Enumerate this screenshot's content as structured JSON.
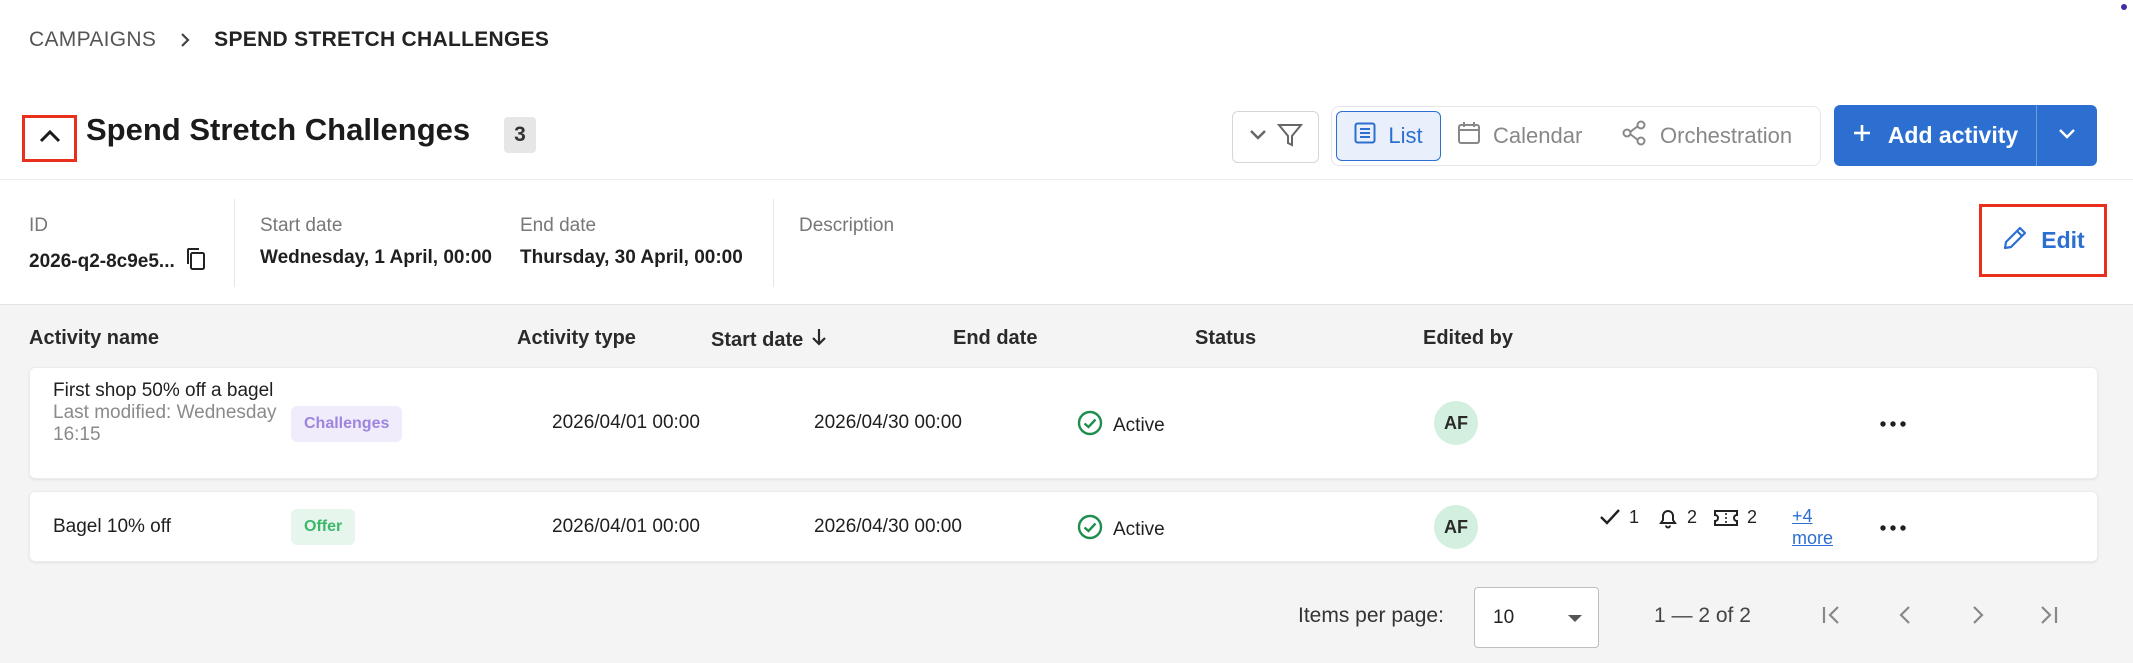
{
  "breadcrumb": {
    "parent": "CAMPAIGNS",
    "current": "SPEND STRETCH CHALLENGES"
  },
  "header": {
    "title": "Spend Stretch Challenges",
    "count": "3"
  },
  "views": {
    "list": "List",
    "calendar": "Calendar",
    "orchestration": "Orchestration"
  },
  "actions": {
    "add_activity": "Add activity",
    "edit": "Edit"
  },
  "meta": {
    "id_label": "ID",
    "id_value": "2026-q2-8c9e5...",
    "start_label": "Start date",
    "start_value": "Wednesday, 1 April, 00:00",
    "end_label": "End date",
    "end_value": "Thursday, 30 April, 00:00",
    "description_label": "Description"
  },
  "table": {
    "columns": {
      "name": "Activity name",
      "type": "Activity type",
      "start": "Start date",
      "end": "End date",
      "status": "Status",
      "edited_by": "Edited by"
    },
    "rows": [
      {
        "name": "First shop 50% off a bagel",
        "modified": "Last modified: Wednesday 16:15",
        "type": "Challenges",
        "start": "2026/04/01 00:00",
        "end": "2026/04/30 00:00",
        "status": "Active",
        "editor": "AF"
      },
      {
        "name": "Bagel 10% off",
        "type": "Offer",
        "start": "2026/04/01 00:00",
        "end": "2026/04/30 00:00",
        "status": "Active",
        "editor": "AF",
        "indicators": {
          "checks": "1",
          "alerts": "2",
          "tickets": "2",
          "more": "+4 more"
        }
      }
    ]
  },
  "pagination": {
    "items_label": "Items per page:",
    "per_page": "10",
    "range": "1 — 2 of 2"
  },
  "colors": {
    "primary": "#2d6fd0",
    "highlight": "#e8301c",
    "active_status": "#1e8e4e",
    "challenges_badge": "#9d84df",
    "offer_badge": "#3db76a"
  }
}
